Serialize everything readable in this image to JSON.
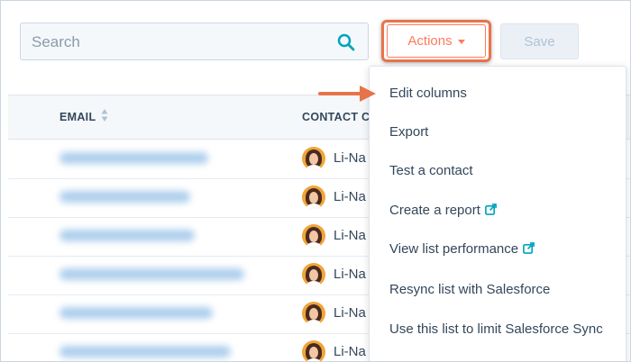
{
  "search": {
    "placeholder": "Search"
  },
  "actions": {
    "label": "Actions"
  },
  "save": {
    "label": "Save"
  },
  "table": {
    "headers": {
      "email": "EMAIL",
      "contact": "CONTACT C"
    },
    "rows": [
      {
        "contact": "Li-Na"
      },
      {
        "contact": "Li-Na"
      },
      {
        "contact": "Li-Na"
      },
      {
        "contact": "Li-Na"
      },
      {
        "contact": "Li-Na"
      },
      {
        "contact": "Li-Na"
      }
    ]
  },
  "menu": {
    "items": [
      {
        "label": "Edit columns",
        "external": false
      },
      {
        "label": "Export",
        "external": false
      },
      {
        "label": "Test a contact",
        "external": false
      },
      {
        "label": "Create a report",
        "external": true
      },
      {
        "label": "View list performance",
        "external": true
      },
      {
        "label": "Resync list with Salesforce",
        "external": false
      },
      {
        "label": "Use this list to limit Salesforce Sync",
        "external": false
      }
    ]
  },
  "colors": {
    "accent": "#ff7a59",
    "callout": "#e8734a",
    "text": "#33475b",
    "search_icon": "#00a4bd"
  }
}
